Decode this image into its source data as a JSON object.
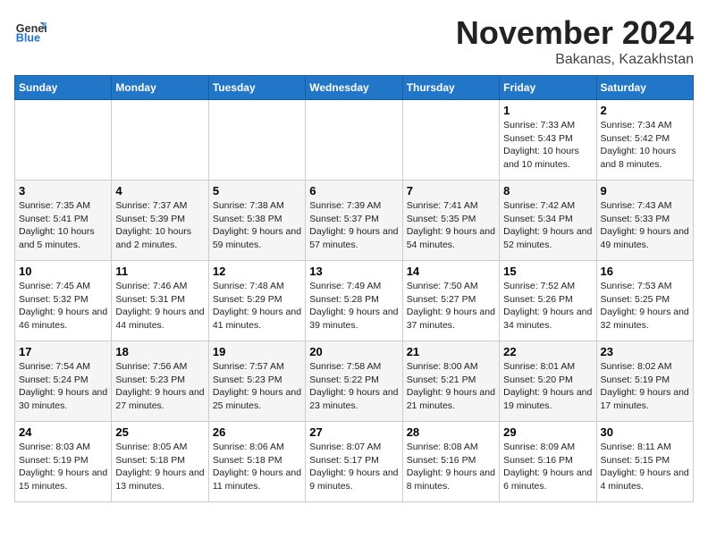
{
  "header": {
    "logo": {
      "general": "General",
      "blue": "Blue"
    },
    "title": "November 2024",
    "location": "Bakanas, Kazakhstan"
  },
  "calendar": {
    "weekdays": [
      "Sunday",
      "Monday",
      "Tuesday",
      "Wednesday",
      "Thursday",
      "Friday",
      "Saturday"
    ],
    "weeks": [
      [
        {
          "day": "",
          "info": ""
        },
        {
          "day": "",
          "info": ""
        },
        {
          "day": "",
          "info": ""
        },
        {
          "day": "",
          "info": ""
        },
        {
          "day": "",
          "info": ""
        },
        {
          "day": "1",
          "info": "Sunrise: 7:33 AM\nSunset: 5:43 PM\nDaylight: 10 hours and 10 minutes."
        },
        {
          "day": "2",
          "info": "Sunrise: 7:34 AM\nSunset: 5:42 PM\nDaylight: 10 hours and 8 minutes."
        }
      ],
      [
        {
          "day": "3",
          "info": "Sunrise: 7:35 AM\nSunset: 5:41 PM\nDaylight: 10 hours and 5 minutes."
        },
        {
          "day": "4",
          "info": "Sunrise: 7:37 AM\nSunset: 5:39 PM\nDaylight: 10 hours and 2 minutes."
        },
        {
          "day": "5",
          "info": "Sunrise: 7:38 AM\nSunset: 5:38 PM\nDaylight: 9 hours and 59 minutes."
        },
        {
          "day": "6",
          "info": "Sunrise: 7:39 AM\nSunset: 5:37 PM\nDaylight: 9 hours and 57 minutes."
        },
        {
          "day": "7",
          "info": "Sunrise: 7:41 AM\nSunset: 5:35 PM\nDaylight: 9 hours and 54 minutes."
        },
        {
          "day": "8",
          "info": "Sunrise: 7:42 AM\nSunset: 5:34 PM\nDaylight: 9 hours and 52 minutes."
        },
        {
          "day": "9",
          "info": "Sunrise: 7:43 AM\nSunset: 5:33 PM\nDaylight: 9 hours and 49 minutes."
        }
      ],
      [
        {
          "day": "10",
          "info": "Sunrise: 7:45 AM\nSunset: 5:32 PM\nDaylight: 9 hours and 46 minutes."
        },
        {
          "day": "11",
          "info": "Sunrise: 7:46 AM\nSunset: 5:31 PM\nDaylight: 9 hours and 44 minutes."
        },
        {
          "day": "12",
          "info": "Sunrise: 7:48 AM\nSunset: 5:29 PM\nDaylight: 9 hours and 41 minutes."
        },
        {
          "day": "13",
          "info": "Sunrise: 7:49 AM\nSunset: 5:28 PM\nDaylight: 9 hours and 39 minutes."
        },
        {
          "day": "14",
          "info": "Sunrise: 7:50 AM\nSunset: 5:27 PM\nDaylight: 9 hours and 37 minutes."
        },
        {
          "day": "15",
          "info": "Sunrise: 7:52 AM\nSunset: 5:26 PM\nDaylight: 9 hours and 34 minutes."
        },
        {
          "day": "16",
          "info": "Sunrise: 7:53 AM\nSunset: 5:25 PM\nDaylight: 9 hours and 32 minutes."
        }
      ],
      [
        {
          "day": "17",
          "info": "Sunrise: 7:54 AM\nSunset: 5:24 PM\nDaylight: 9 hours and 30 minutes."
        },
        {
          "day": "18",
          "info": "Sunrise: 7:56 AM\nSunset: 5:23 PM\nDaylight: 9 hours and 27 minutes."
        },
        {
          "day": "19",
          "info": "Sunrise: 7:57 AM\nSunset: 5:23 PM\nDaylight: 9 hours and 25 minutes."
        },
        {
          "day": "20",
          "info": "Sunrise: 7:58 AM\nSunset: 5:22 PM\nDaylight: 9 hours and 23 minutes."
        },
        {
          "day": "21",
          "info": "Sunrise: 8:00 AM\nSunset: 5:21 PM\nDaylight: 9 hours and 21 minutes."
        },
        {
          "day": "22",
          "info": "Sunrise: 8:01 AM\nSunset: 5:20 PM\nDaylight: 9 hours and 19 minutes."
        },
        {
          "day": "23",
          "info": "Sunrise: 8:02 AM\nSunset: 5:19 PM\nDaylight: 9 hours and 17 minutes."
        }
      ],
      [
        {
          "day": "24",
          "info": "Sunrise: 8:03 AM\nSunset: 5:19 PM\nDaylight: 9 hours and 15 minutes."
        },
        {
          "day": "25",
          "info": "Sunrise: 8:05 AM\nSunset: 5:18 PM\nDaylight: 9 hours and 13 minutes."
        },
        {
          "day": "26",
          "info": "Sunrise: 8:06 AM\nSunset: 5:18 PM\nDaylight: 9 hours and 11 minutes."
        },
        {
          "day": "27",
          "info": "Sunrise: 8:07 AM\nSunset: 5:17 PM\nDaylight: 9 hours and 9 minutes."
        },
        {
          "day": "28",
          "info": "Sunrise: 8:08 AM\nSunset: 5:16 PM\nDaylight: 9 hours and 8 minutes."
        },
        {
          "day": "29",
          "info": "Sunrise: 8:09 AM\nSunset: 5:16 PM\nDaylight: 9 hours and 6 minutes."
        },
        {
          "day": "30",
          "info": "Sunrise: 8:11 AM\nSunset: 5:15 PM\nDaylight: 9 hours and 4 minutes."
        }
      ]
    ]
  }
}
